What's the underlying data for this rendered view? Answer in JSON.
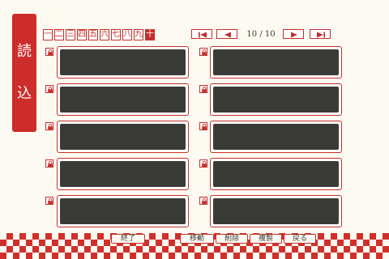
{
  "title": {
    "line1": "読",
    "line2": "込"
  },
  "kanji_tabs": [
    {
      "label": "一",
      "active": false
    },
    {
      "label": "二",
      "active": false
    },
    {
      "label": "三",
      "active": false
    },
    {
      "label": "四",
      "active": false
    },
    {
      "label": "五",
      "active": false
    },
    {
      "label": "六",
      "active": false
    },
    {
      "label": "七",
      "active": false
    },
    {
      "label": "八",
      "active": false
    },
    {
      "label": "九",
      "active": false
    },
    {
      "label": "十",
      "active": true
    }
  ],
  "pagination": {
    "current": "10",
    "separator": "/",
    "total": "10",
    "first_icon": "skip-first-icon",
    "prev_icon": "prev-icon",
    "next_icon": "next-icon",
    "last_icon": "skip-last-icon"
  },
  "slots": {
    "count": 10,
    "lock_icon": "lock-icon"
  },
  "bottom_buttons": {
    "end": "終了",
    "move": "移動",
    "delete": "削除",
    "copy": "複製",
    "back": "戻る"
  },
  "colors": {
    "accent": "#c4302c",
    "slot_fill": "#3a3a37",
    "background": "#fdfaf1"
  }
}
